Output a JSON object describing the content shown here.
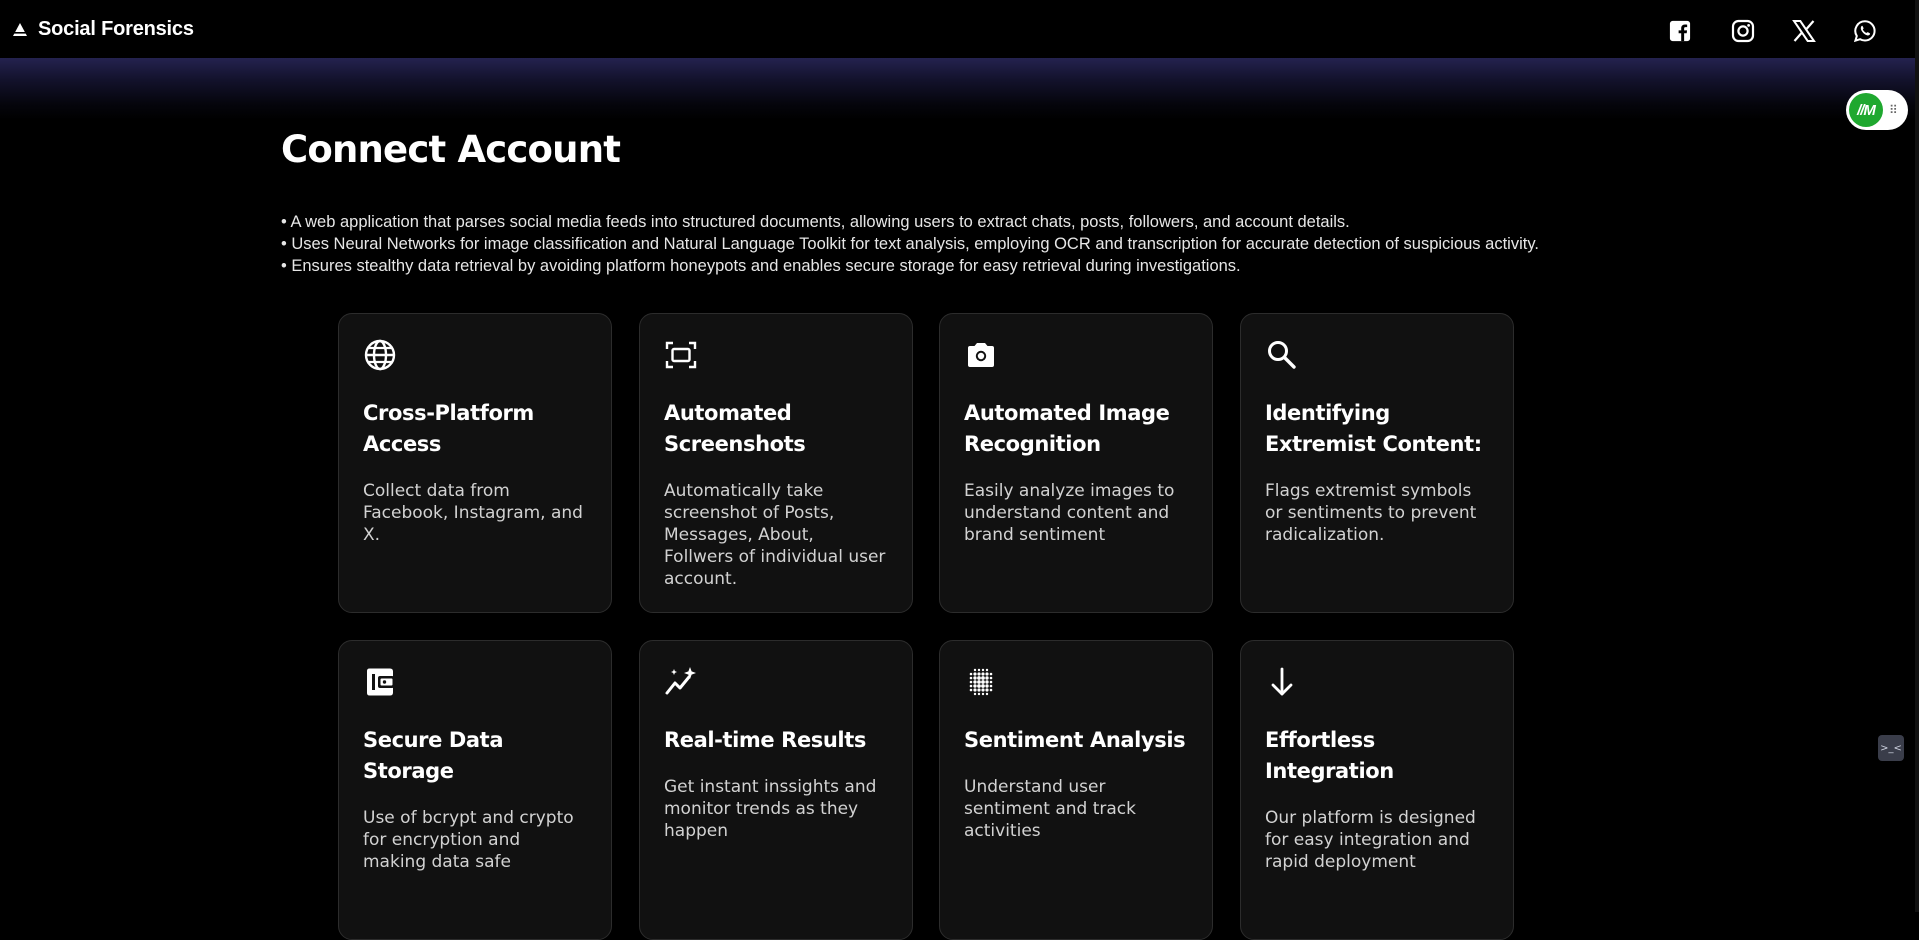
{
  "header": {
    "brand_name": "Social Forensics",
    "social_links": [
      {
        "icon": "facebook-icon"
      },
      {
        "icon": "instagram-icon"
      },
      {
        "icon": "x-twitter-icon"
      },
      {
        "icon": "whatsapp-icon"
      }
    ]
  },
  "widget": {
    "badge_text": "//M"
  },
  "main": {
    "title": "Connect Account",
    "bullets": [
      "• A web application that parses social media feeds into structured documents, allowing users to extract chats, posts, followers, and account details.",
      "• Uses Neural Networks for image classification and Natural Language Toolkit for text analysis, employing OCR and transcription for accurate detection of suspicious activity.",
      "• Ensures stealthy data retrieval by avoiding platform honeypots and enables secure storage for easy retrieval during investigations."
    ]
  },
  "features": [
    {
      "icon": "globe-icon",
      "title": "Cross-Platform Access",
      "desc": "Collect data from Facebook, Instagram, and X."
    },
    {
      "icon": "screenshot-icon",
      "title": "Automated Screenshots",
      "desc": "Automatically take screenshot of Posts, Messages, About, Follwers of individual user account."
    },
    {
      "icon": "camera-icon",
      "title": "Automated Image Recognition",
      "desc": "Easily analyze images to understand content and brand sentiment"
    },
    {
      "icon": "search-icon",
      "title": "Identifying Extremist Content:",
      "desc": "Flags extremist symbols or sentiments to prevent radicalization."
    },
    {
      "icon": "wallet-icon",
      "title": "Secure Data Storage",
      "desc": "Use of bcrypt and crypto for encryption and making data safe"
    },
    {
      "icon": "trend-sparkle-icon",
      "title": "Real-time Results",
      "desc": "Get instant inssights and monitor trends as they happen"
    },
    {
      "icon": "dot-grid-icon",
      "title": "Sentiment Analysis",
      "desc": "Understand user sentiment and track activities"
    },
    {
      "icon": "arrow-down-icon",
      "title": "Effortless Integration",
      "desc": "Our platform is designed for easy integration and rapid deployment"
    }
  ],
  "colors": {
    "background": "#000000",
    "card_background": "#111111",
    "card_border": "#2c2c2c",
    "glow": "#24224f",
    "widget_green": "#1fa82f"
  }
}
